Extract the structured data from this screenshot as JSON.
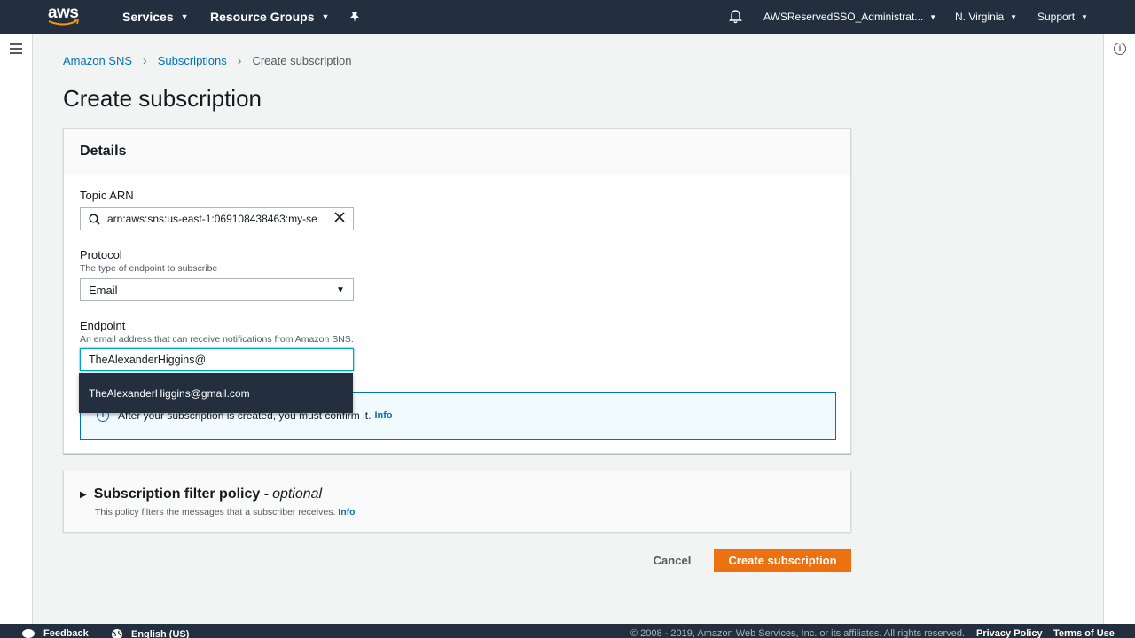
{
  "topnav": {
    "logo_text": "aws",
    "services": "Services",
    "resource_groups": "Resource Groups",
    "account": "AWSReservedSSO_Administrat...",
    "region": "N. Virginia",
    "support": "Support"
  },
  "breadcrumb": {
    "root": "Amazon SNS",
    "section": "Subscriptions",
    "current": "Create subscription"
  },
  "page": {
    "title": "Create subscription"
  },
  "details": {
    "header": "Details",
    "topic_arn": {
      "label": "Topic ARN",
      "value": "arn:aws:sns:us-east-1:069108438463:my-se"
    },
    "protocol": {
      "label": "Protocol",
      "description": "The type of endpoint to subscribe",
      "value": "Email"
    },
    "endpoint": {
      "label": "Endpoint",
      "description": "An email address that can receive notifications from Amazon SNS.",
      "value": "TheAlexanderHiggins@"
    },
    "autocomplete_option": "TheAlexanderHiggins@gmail.com",
    "alert": {
      "text": "After your subscription is created, you must confirm it.",
      "link": "Info"
    }
  },
  "filter_policy": {
    "title": "Subscription filter policy -",
    "optional": "optional",
    "description": "This policy filters the messages that a subscriber receives.",
    "link": "Info"
  },
  "actions": {
    "cancel": "Cancel",
    "create": "Create subscription"
  },
  "footer": {
    "feedback": "Feedback",
    "language": "English (US)",
    "copyright": "© 2008 - 2019, Amazon Web Services, Inc. or its affiliates. All rights reserved.",
    "privacy": "Privacy Policy",
    "terms": "Terms of Use"
  },
  "colors": {
    "nav_bg": "#232f3e",
    "link": "#0073bb",
    "primary_button": "#ec7211",
    "focus": "#00a1c9"
  }
}
